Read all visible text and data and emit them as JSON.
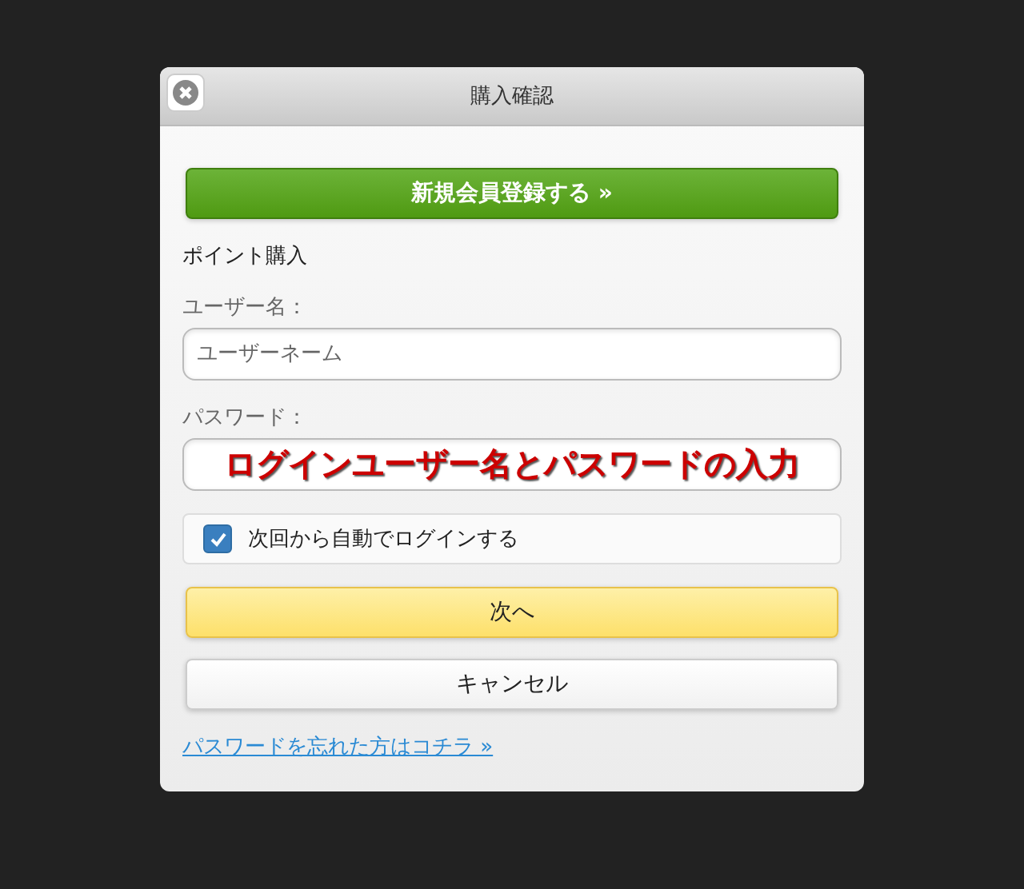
{
  "dialog": {
    "title": "購入確認",
    "close_button": {
      "kind": "close"
    }
  },
  "register_button": "新規会員登録する »",
  "section_title": "ポイント購入",
  "username": {
    "label": "ユーザー名：",
    "placeholder": "ユーザーネーム"
  },
  "password": {
    "label": "パスワード：",
    "annotation": "ログインユーザー名とパスワードの入力"
  },
  "auto_login": {
    "label": "次回から自動でログインする",
    "checked": true
  },
  "next_button": "次へ",
  "cancel_button": "キャンセル",
  "forgot_link": "パスワードを忘れた方はコチラ »"
}
